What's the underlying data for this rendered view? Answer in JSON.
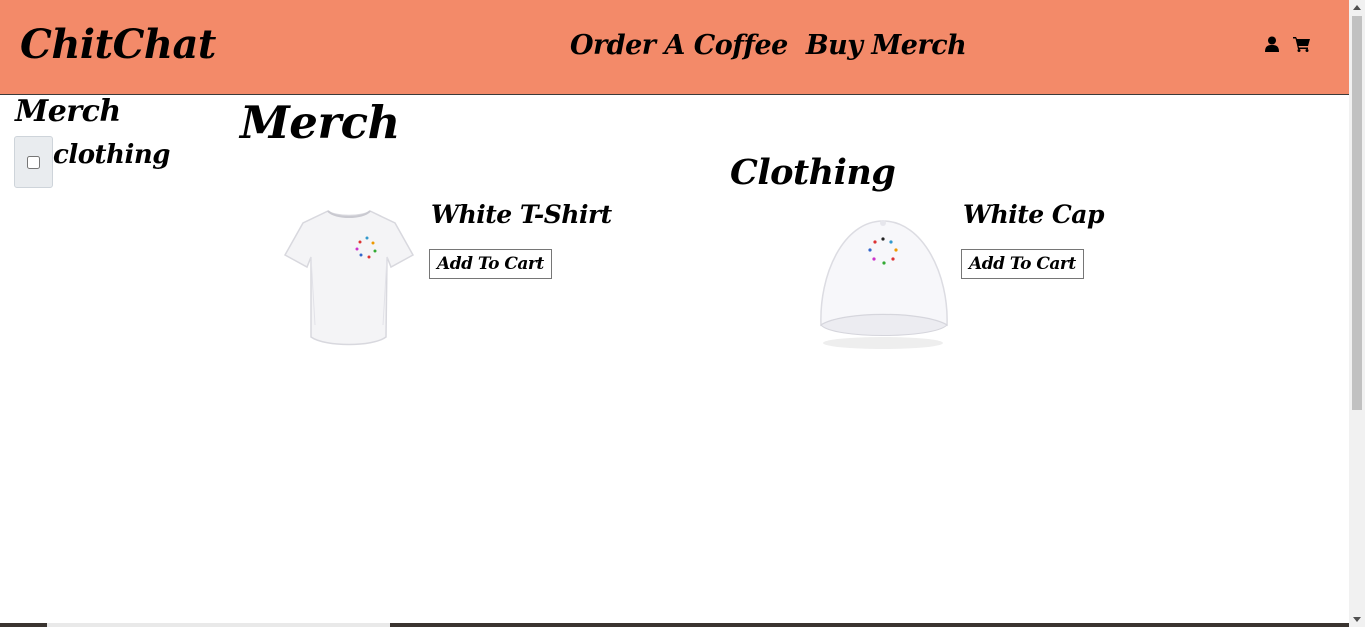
{
  "header": {
    "logo": "ChitChat",
    "nav": [
      {
        "label": "Order A Coffee"
      },
      {
        "label": "Buy Merch"
      }
    ],
    "icons": [
      "user-icon",
      "cart-icon"
    ],
    "background": "#f38a69"
  },
  "sidebar": {
    "title": "Merch",
    "filters": [
      {
        "label": "clothing",
        "checked": false
      }
    ]
  },
  "main": {
    "title": "Merch",
    "section": "Clothing",
    "products": [
      {
        "name": "White T-Shirt",
        "button": "Add To Cart",
        "image": "t-shirt"
      },
      {
        "name": "White Cap",
        "button": "Add To Cart",
        "image": "cap"
      }
    ]
  }
}
